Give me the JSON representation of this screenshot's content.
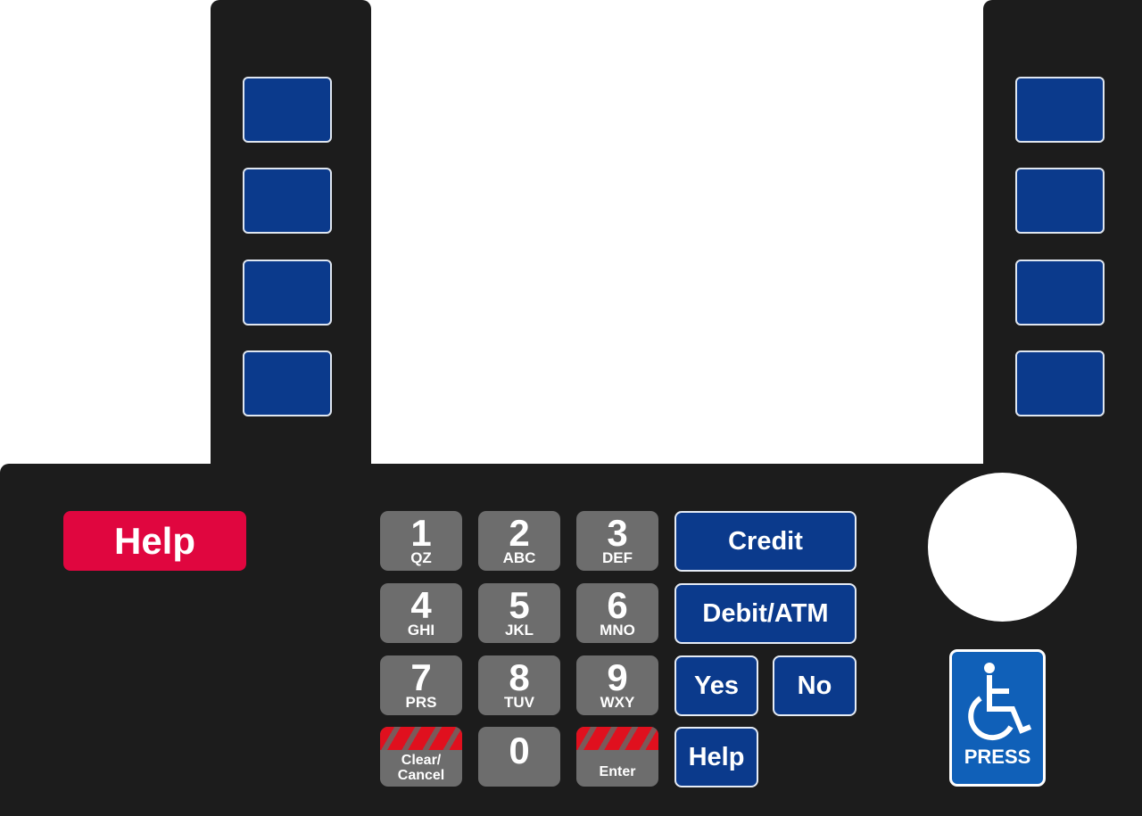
{
  "help_red": "Help",
  "keys": [
    {
      "digit": "1",
      "letters": "QZ"
    },
    {
      "digit": "2",
      "letters": "ABC"
    },
    {
      "digit": "3",
      "letters": "DEF"
    },
    {
      "digit": "4",
      "letters": "GHI"
    },
    {
      "digit": "5",
      "letters": "JKL"
    },
    {
      "digit": "6",
      "letters": "MNO"
    },
    {
      "digit": "7",
      "letters": "PRS"
    },
    {
      "digit": "8",
      "letters": "TUV"
    },
    {
      "digit": "9",
      "letters": "WXY"
    }
  ],
  "clear": "Clear/ Cancel",
  "zero": "0",
  "enter": "Enter",
  "credit": "Credit",
  "debit": "Debit/ATM",
  "yes": "Yes",
  "no": "No",
  "help_blue": "Help",
  "press": "PRESS",
  "colors": {
    "panel": "#1c1c1c",
    "blue": "#0b3a8c",
    "red": "#e0063f",
    "gray": "#6d6d6d",
    "access": "#1060b8"
  }
}
